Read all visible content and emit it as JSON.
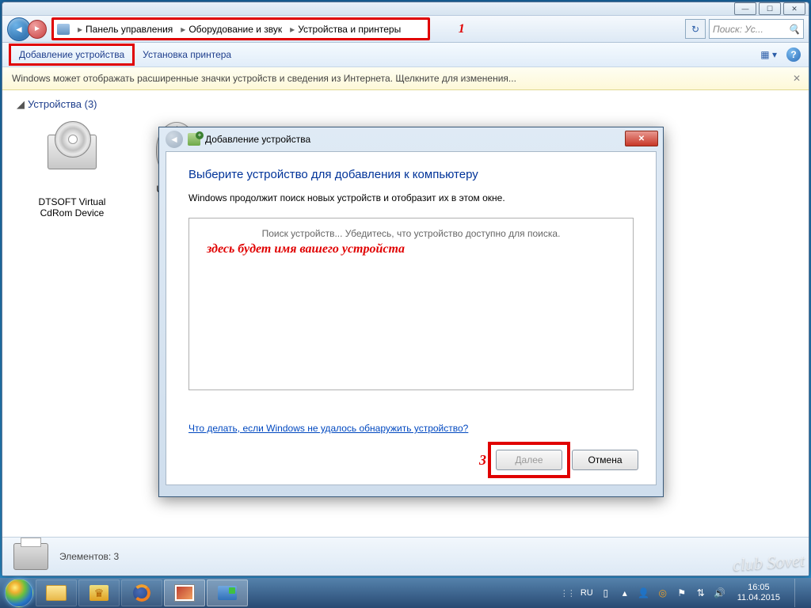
{
  "breadcrumb": {
    "p1": "Панель управления",
    "p2": "Оборудование и звук",
    "p3": "Устройства и принтеры"
  },
  "annotations": {
    "a1": "1",
    "a2": "здесь будет имя вашего устройста",
    "a3": "3"
  },
  "search": {
    "placeholder": "Поиск: Ус..."
  },
  "toolbar": {
    "add_device": "Добавление устройства",
    "add_printer": "Установка принтера"
  },
  "infobar": {
    "text": "Windows может отображать расширенные значки устройств и сведения из Интернета.  Щелкните для изменения..."
  },
  "section": {
    "title": "Устройства (3)"
  },
  "devices": [
    {
      "label": "DTSOFT Virtual CdRom Device"
    },
    {
      "label": "USB Mou"
    }
  ],
  "statusbar": {
    "text": "Элементов: 3"
  },
  "modal": {
    "title": "Добавление устройства",
    "h1": "Выберите устройство для добавления к компьютеру",
    "p": "Windows продолжит поиск новых устройств и отобразит их в этом окне.",
    "searching": "Поиск устройств... Убедитесь, что устройство доступно для поиска.",
    "help_link": "Что делать, если Windows не удалось обнаружить устройство?",
    "next": "Далее",
    "cancel": "Отмена"
  },
  "tray": {
    "lang": "RU",
    "time": "16:05",
    "date": "11.04.2015"
  },
  "watermark": "club Sovet"
}
